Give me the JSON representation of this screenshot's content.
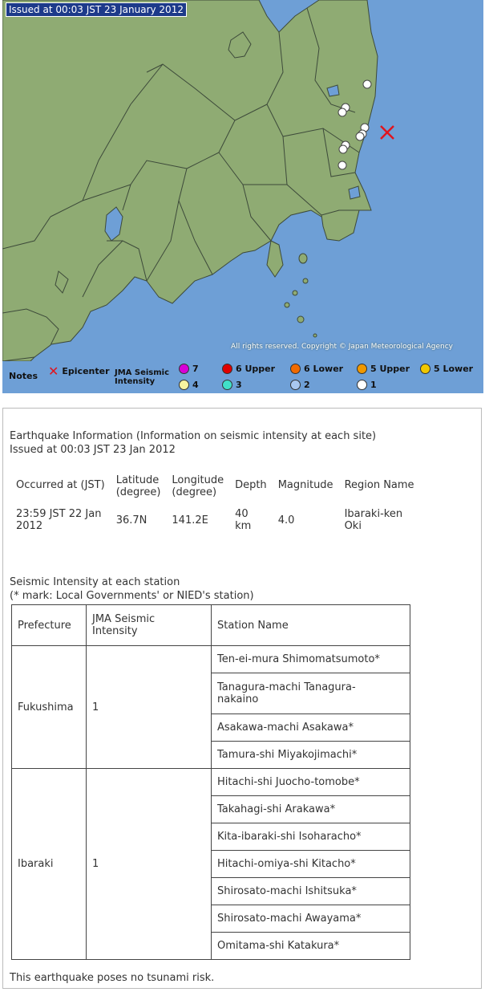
{
  "map": {
    "issued_label": "Issued at 00:03 JST  23 January 2012",
    "copyright": "All rights reserved. Copyright © Japan Meteorological Agency",
    "colors": {
      "sea": "#6e9fd6",
      "land": "#8fab73",
      "border": "#3d4a3a",
      "epicenter": "#e0141e",
      "intensity_1": "#ffffff"
    }
  },
  "legend": {
    "notes": "Notes",
    "epicenter": "Epicenter",
    "jma_line1": "JMA Seismic",
    "jma_line2": "Intensity",
    "items": [
      {
        "label": "7",
        "color": "#d800d8"
      },
      {
        "label": "6 Upper",
        "color": "#e00000"
      },
      {
        "label": "6 Lower",
        "color": "#f06a00"
      },
      {
        "label": "5 Upper",
        "color": "#f09800"
      },
      {
        "label": "5 Lower",
        "color": "#f0c800"
      },
      {
        "label": "4",
        "color": "#f8f4a0"
      },
      {
        "label": "3",
        "color": "#40e0c8"
      },
      {
        "label": "2",
        "color": "#a8c8f0"
      },
      {
        "label": "1",
        "color": "#ffffff"
      }
    ]
  },
  "info": {
    "heading": "Earthquake Information (Information on seismic intensity at each site)",
    "issued": "Issued at 00:03 JST 23 Jan 2012",
    "summary_headers": {
      "occurred": "Occurred at (JST)",
      "lat1": "Latitude",
      "lat2": "(degree)",
      "lon1": "Longitude",
      "lon2": "(degree)",
      "depth": "Depth",
      "magnitude": "Magnitude",
      "region": "Region Name"
    },
    "summary_values": {
      "occurred1": "23:59 JST 22 Jan",
      "occurred2": "2012",
      "lat": "36.7N",
      "lon": "141.2E",
      "depth1": "40",
      "depth2": "km",
      "magnitude": "4.0",
      "region1": "Ibaraki-ken",
      "region2": "Oki"
    },
    "station_title1": "Seismic Intensity at each station",
    "station_title2": "(* mark: Local Governments' or NIED's station)",
    "table_headers": {
      "prefecture": "Prefecture",
      "intensity1": "JMA Seismic",
      "intensity2": "Intensity",
      "station": "Station Name"
    },
    "fukushima": {
      "prefecture": "Fukushima",
      "intensity": "1",
      "stations": [
        "Ten-ei-mura Shimomatsumoto*",
        "Tanagura-machi Tanagura-",
        "nakaino",
        "Asakawa-machi Asakawa*",
        "Tamura-shi Miyakojimachi*"
      ]
    },
    "ibaraki": {
      "prefecture": "Ibaraki",
      "intensity": "1",
      "stations": [
        "Hitachi-shi Juocho-tomobe*",
        "Takahagi-shi Arakawa*",
        "Kita-ibaraki-shi Isoharacho*",
        "Hitachi-omiya-shi Kitacho*",
        "Shirosato-machi Ishitsuka*",
        "Shirosato-machi Awayama*",
        "Omitama-shi Katakura*"
      ]
    },
    "tsunami": "This earthquake poses no tsunami risk."
  }
}
